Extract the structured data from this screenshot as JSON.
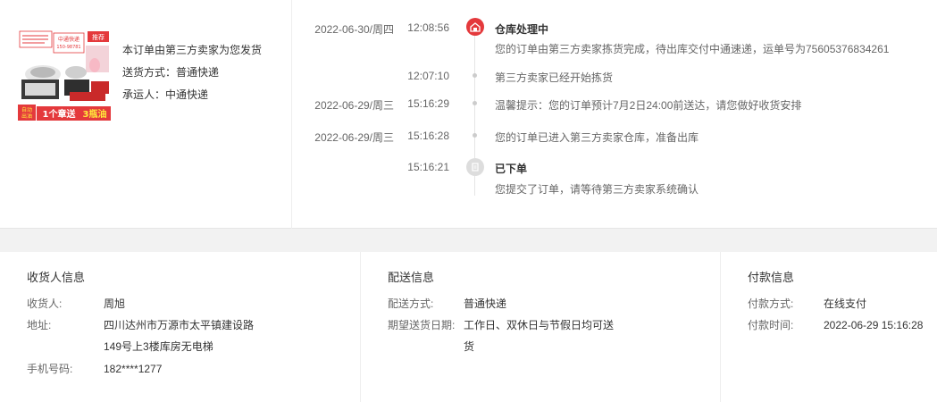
{
  "seller": {
    "line1": "本订单由第三方卖家为您发货",
    "line2": "送货方式：普通快递",
    "line3": "承运人：中通快递",
    "thumb": {
      "tag": "推荐",
      "express_tag": "中通快递",
      "express_num": "150-98781",
      "badge_auto": "自动出油",
      "promo_a": "1个章送",
      "promo_b": "3瓶油"
    }
  },
  "timeline": [
    {
      "date": "2022-06-30/周四",
      "time": "12:08:56",
      "title": "仓库处理中",
      "text": "您的订单由第三方卖家拣货完成，待出库交付中通速递，运单号为75605376834261"
    },
    {
      "date": "",
      "time": "12:07:10",
      "title": "",
      "text": "第三方卖家已经开始拣货"
    },
    {
      "date": "2022-06-29/周三",
      "time": "15:16:29",
      "title": "",
      "text": "温馨提示：您的订单预计7月2日24:00前送达，请您做好收货安排"
    },
    {
      "date": "2022-06-29/周三",
      "time": "15:16:28",
      "title": "",
      "text": "您的订单已进入第三方卖家仓库，准备出库"
    },
    {
      "date": "",
      "time": "15:16:21",
      "title": "已下单",
      "text": "您提交了订单，请等待第三方卖家系统确认"
    }
  ],
  "receiver": {
    "title": "收货人信息",
    "name_k": "收货人:",
    "name_v": "周旭",
    "addr_k": "地址:",
    "addr_v1": "四川达州市万源市太平镇建设路",
    "addr_v2": "149号上3楼库房无电梯",
    "phone_k": "手机号码:",
    "phone_v": "182****1277"
  },
  "delivery": {
    "title": "配送信息",
    "method_k": "配送方式:",
    "method_v": "普通快递",
    "date_k": "期望送货日期:",
    "date_v1": "工作日、双休日与节假日均可送",
    "date_v2": "货"
  },
  "payment": {
    "title": "付款信息",
    "method_k": "付款方式:",
    "method_v": "在线支付",
    "time_k": "付款时间:",
    "time_v": "2022-06-29 15:16:28"
  },
  "colors": {
    "accent": "#e4393c",
    "muted": "#666666"
  }
}
